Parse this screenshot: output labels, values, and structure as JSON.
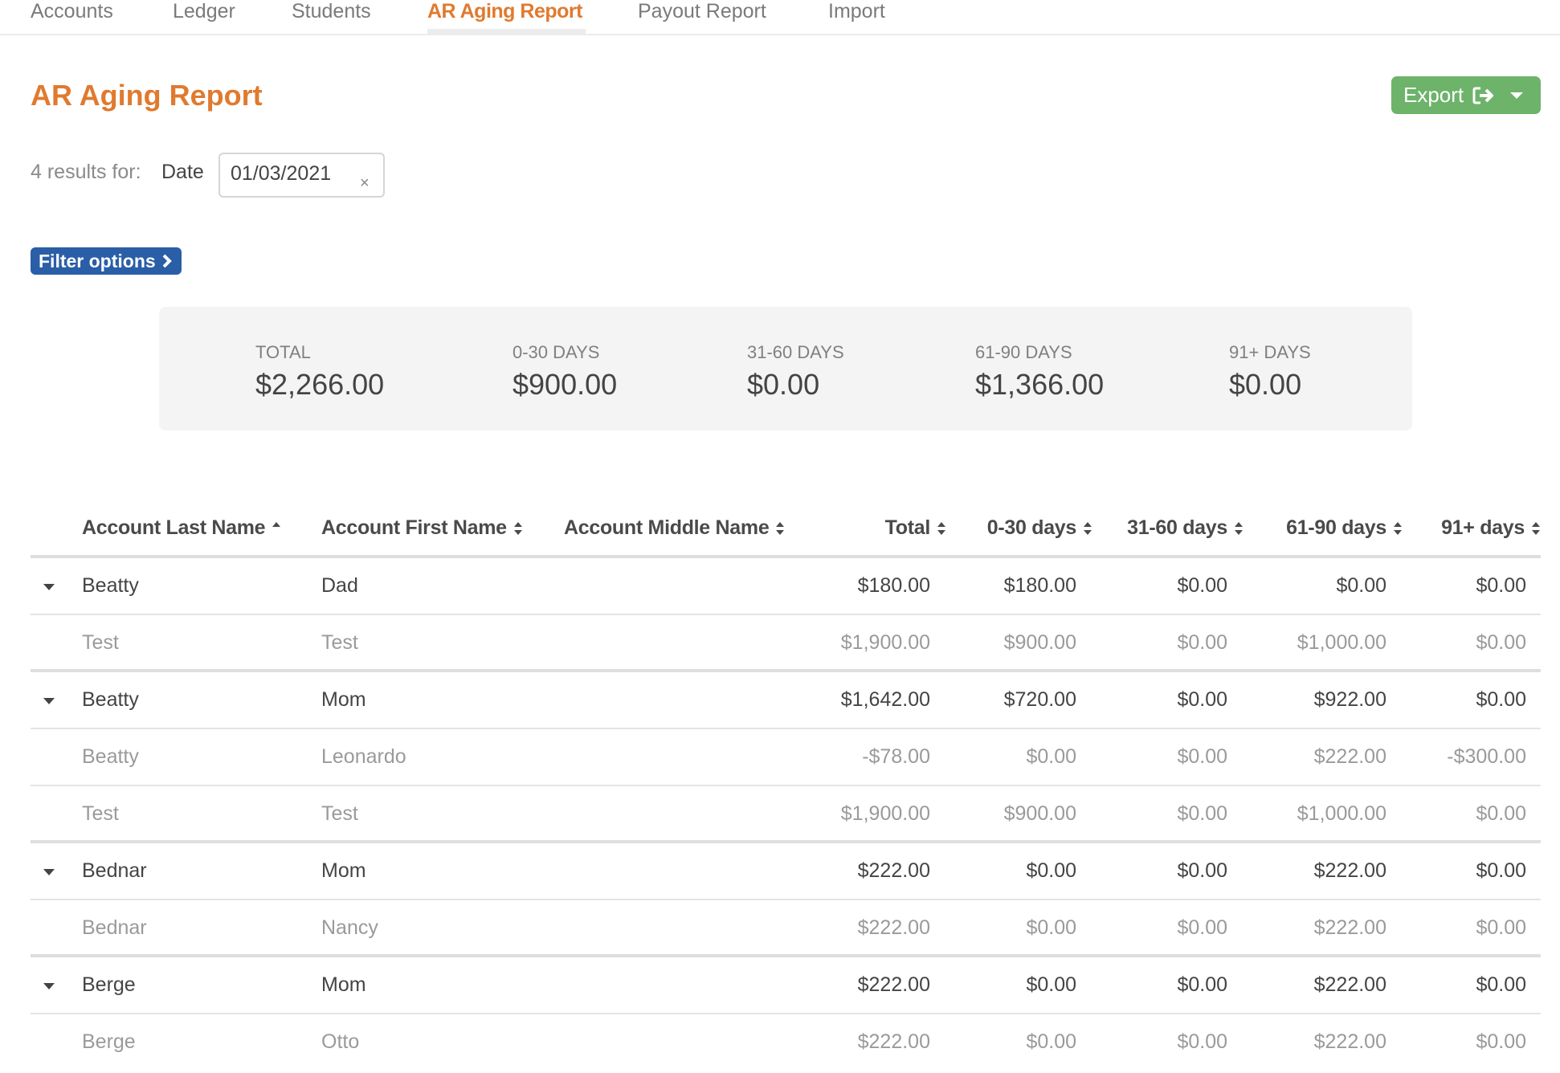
{
  "nav": {
    "items": [
      {
        "label": "Accounts",
        "active": false
      },
      {
        "label": "Ledger",
        "active": false
      },
      {
        "label": "Students",
        "active": false
      },
      {
        "label": "AR Aging Report",
        "active": true
      },
      {
        "label": "Payout Report",
        "active": false
      },
      {
        "label": "Import",
        "active": false
      }
    ]
  },
  "page": {
    "title": "AR Aging Report",
    "export_label": "Export",
    "export_icon": "sign-out-icon",
    "results_text": "4 results for:",
    "date_label": "Date",
    "date_value": "01/03/2021",
    "clear_symbol": "×",
    "filter_label": "Filter options"
  },
  "colors": {
    "accent": "#e07a2f",
    "export_green": "#6db36a",
    "filter_blue": "#2a5ea6",
    "summary_bg": "#f4f4f4"
  },
  "summary": [
    {
      "label": "TOTAL",
      "value": "$2,266.00"
    },
    {
      "label": "0-30 DAYS",
      "value": "$900.00"
    },
    {
      "label": "31-60 DAYS",
      "value": "$0.00"
    },
    {
      "label": "61-90 DAYS",
      "value": "$1,366.00"
    },
    {
      "label": "91+ DAYS",
      "value": "$0.00"
    }
  ],
  "table": {
    "columns": [
      {
        "label": "Account Last Name",
        "sort": "asc"
      },
      {
        "label": "Account First Name",
        "sort": "none"
      },
      {
        "label": "Account Middle Name",
        "sort": "none"
      },
      {
        "label": "Total",
        "sort": "none"
      },
      {
        "label": "0-30 days",
        "sort": "none"
      },
      {
        "label": "31-60 days",
        "sort": "none"
      },
      {
        "label": "61-90 days",
        "sort": "none"
      },
      {
        "label": "91+ days",
        "sort": "none"
      }
    ],
    "rows": [
      {
        "type": "parent",
        "last": "Beatty",
        "first": "Dad",
        "middle": "",
        "total": "$180.00",
        "d0_30": "$180.00",
        "d31_60": "$0.00",
        "d61_90": "$0.00",
        "d91": "$0.00"
      },
      {
        "type": "child",
        "last": "Test",
        "first": "Test",
        "middle": "",
        "total": "$1,900.00",
        "d0_30": "$900.00",
        "d31_60": "$0.00",
        "d61_90": "$1,000.00",
        "d91": "$0.00"
      },
      {
        "type": "parent",
        "last": "Beatty",
        "first": "Mom",
        "middle": "",
        "total": "$1,642.00",
        "d0_30": "$720.00",
        "d31_60": "$0.00",
        "d61_90": "$922.00",
        "d91": "$0.00"
      },
      {
        "type": "child",
        "last": "Beatty",
        "first": "Leonardo",
        "middle": "",
        "total": "-$78.00",
        "d0_30": "$0.00",
        "d31_60": "$0.00",
        "d61_90": "$222.00",
        "d91": "-$300.00"
      },
      {
        "type": "child",
        "last": "Test",
        "first": "Test",
        "middle": "",
        "total": "$1,900.00",
        "d0_30": "$900.00",
        "d31_60": "$0.00",
        "d61_90": "$1,000.00",
        "d91": "$0.00"
      },
      {
        "type": "parent",
        "last": "Bednar",
        "first": "Mom",
        "middle": "",
        "total": "$222.00",
        "d0_30": "$0.00",
        "d31_60": "$0.00",
        "d61_90": "$222.00",
        "d91": "$0.00"
      },
      {
        "type": "child",
        "last": "Bednar",
        "first": "Nancy",
        "middle": "",
        "total": "$222.00",
        "d0_30": "$0.00",
        "d31_60": "$0.00",
        "d61_90": "$222.00",
        "d91": "$0.00"
      },
      {
        "type": "parent",
        "last": "Berge",
        "first": "Mom",
        "middle": "",
        "total": "$222.00",
        "d0_30": "$0.00",
        "d31_60": "$0.00",
        "d61_90": "$222.00",
        "d91": "$0.00"
      },
      {
        "type": "child",
        "last": "Berge",
        "first": "Otto",
        "middle": "",
        "total": "$222.00",
        "d0_30": "$0.00",
        "d31_60": "$0.00",
        "d61_90": "$222.00",
        "d91": "$0.00"
      }
    ]
  }
}
